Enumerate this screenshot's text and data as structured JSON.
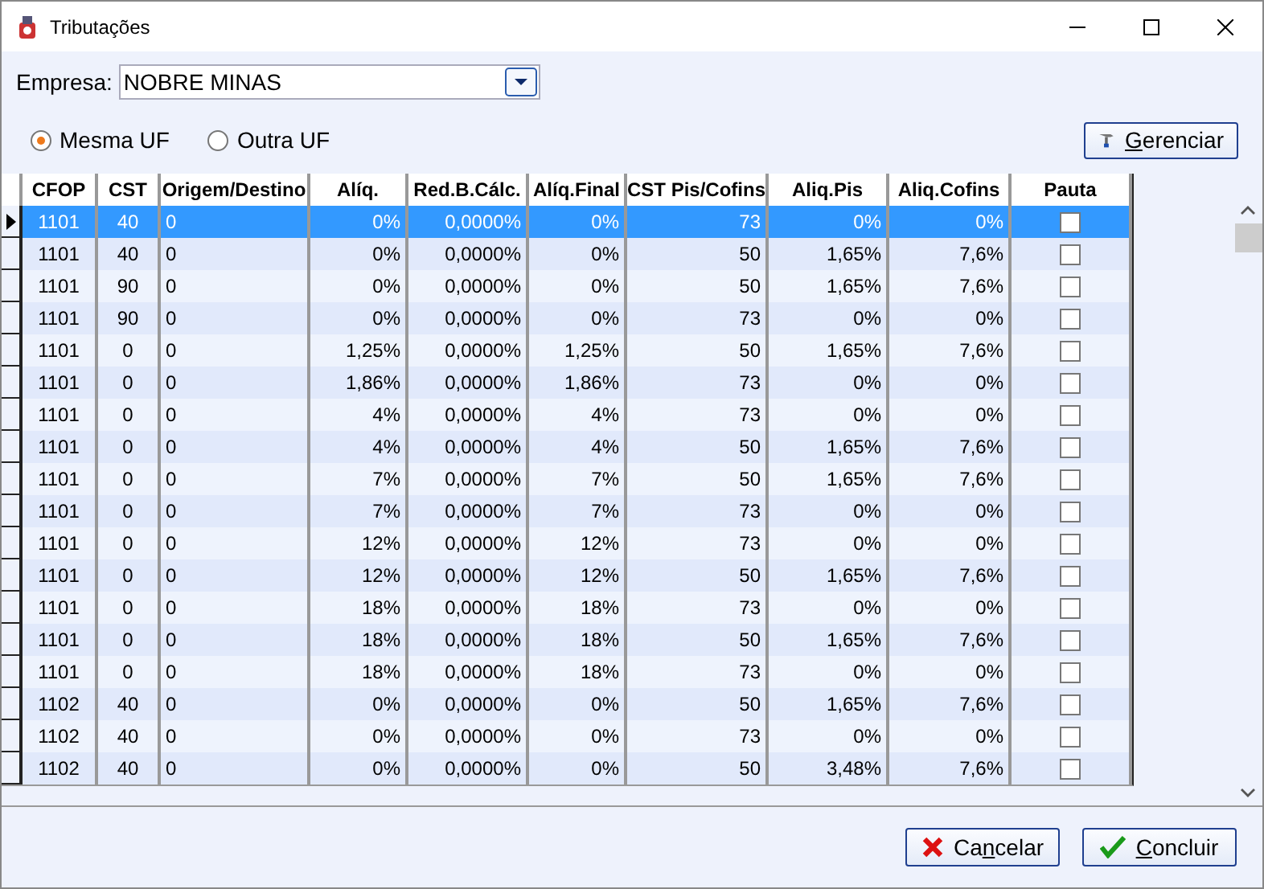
{
  "window": {
    "title": "Tributações"
  },
  "empresa": {
    "label": "Empresa:",
    "value": "NOBRE MINAS"
  },
  "radios": [
    {
      "label": "Mesma UF",
      "selected": true
    },
    {
      "label": "Outra UF",
      "selected": false
    }
  ],
  "manage_button": {
    "accel": "G",
    "after": "erenciar"
  },
  "table": {
    "columns": [
      "CFOP",
      "CST",
      "Origem/Destino",
      "Alíq.",
      "Red.B.Cálc.",
      "Alíq.Final",
      "CST Pis/Cofins",
      "Aliq.Pis",
      "Aliq.Cofins",
      "Pauta"
    ],
    "rows": [
      {
        "selected": true,
        "cells": [
          "1101",
          "40",
          "0",
          "0%",
          "0,0000%",
          "0%",
          "73",
          "0%",
          "0%"
        ],
        "pauta": false
      },
      {
        "selected": false,
        "cells": [
          "1101",
          "40",
          "0",
          "0%",
          "0,0000%",
          "0%",
          "50",
          "1,65%",
          "7,6%"
        ],
        "pauta": false
      },
      {
        "selected": false,
        "cells": [
          "1101",
          "90",
          "0",
          "0%",
          "0,0000%",
          "0%",
          "50",
          "1,65%",
          "7,6%"
        ],
        "pauta": false
      },
      {
        "selected": false,
        "cells": [
          "1101",
          "90",
          "0",
          "0%",
          "0,0000%",
          "0%",
          "73",
          "0%",
          "0%"
        ],
        "pauta": false
      },
      {
        "selected": false,
        "cells": [
          "1101",
          "0",
          "0",
          "1,25%",
          "0,0000%",
          "1,25%",
          "50",
          "1,65%",
          "7,6%"
        ],
        "pauta": false
      },
      {
        "selected": false,
        "cells": [
          "1101",
          "0",
          "0",
          "1,86%",
          "0,0000%",
          "1,86%",
          "73",
          "0%",
          "0%"
        ],
        "pauta": false
      },
      {
        "selected": false,
        "cells": [
          "1101",
          "0",
          "0",
          "4%",
          "0,0000%",
          "4%",
          "73",
          "0%",
          "0%"
        ],
        "pauta": false
      },
      {
        "selected": false,
        "cells": [
          "1101",
          "0",
          "0",
          "4%",
          "0,0000%",
          "4%",
          "50",
          "1,65%",
          "7,6%"
        ],
        "pauta": false
      },
      {
        "selected": false,
        "cells": [
          "1101",
          "0",
          "0",
          "7%",
          "0,0000%",
          "7%",
          "50",
          "1,65%",
          "7,6%"
        ],
        "pauta": false
      },
      {
        "selected": false,
        "cells": [
          "1101",
          "0",
          "0",
          "7%",
          "0,0000%",
          "7%",
          "73",
          "0%",
          "0%"
        ],
        "pauta": false
      },
      {
        "selected": false,
        "cells": [
          "1101",
          "0",
          "0",
          "12%",
          "0,0000%",
          "12%",
          "73",
          "0%",
          "0%"
        ],
        "pauta": false
      },
      {
        "selected": false,
        "cells": [
          "1101",
          "0",
          "0",
          "12%",
          "0,0000%",
          "12%",
          "50",
          "1,65%",
          "7,6%"
        ],
        "pauta": false
      },
      {
        "selected": false,
        "cells": [
          "1101",
          "0",
          "0",
          "18%",
          "0,0000%",
          "18%",
          "73",
          "0%",
          "0%"
        ],
        "pauta": false
      },
      {
        "selected": false,
        "cells": [
          "1101",
          "0",
          "0",
          "18%",
          "0,0000%",
          "18%",
          "50",
          "1,65%",
          "7,6%"
        ],
        "pauta": false
      },
      {
        "selected": false,
        "cells": [
          "1101",
          "0",
          "0",
          "18%",
          "0,0000%",
          "18%",
          "73",
          "0%",
          "0%"
        ],
        "pauta": false
      },
      {
        "selected": false,
        "cells": [
          "1102",
          "40",
          "0",
          "0%",
          "0,0000%",
          "0%",
          "50",
          "1,65%",
          "7,6%"
        ],
        "pauta": false
      },
      {
        "selected": false,
        "cells": [
          "1102",
          "40",
          "0",
          "0%",
          "0,0000%",
          "0%",
          "73",
          "0%",
          "0%"
        ],
        "pauta": false
      },
      {
        "selected": false,
        "cells": [
          "1102",
          "40",
          "0",
          "0%",
          "0,0000%",
          "0%",
          "50",
          "3,48%",
          "7,6%"
        ],
        "pauta": false
      }
    ]
  },
  "buttons": [
    {
      "kind": "cancel",
      "before": "Ca",
      "accel": "n",
      "after": "celar"
    },
    {
      "kind": "ok",
      "accel": "C",
      "after": "oncluir"
    }
  ]
}
